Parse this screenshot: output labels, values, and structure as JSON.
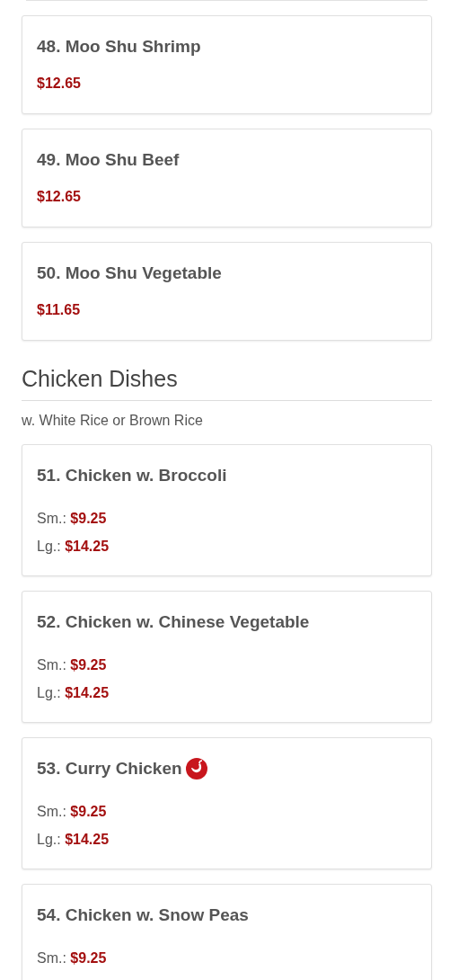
{
  "items_before": [
    {
      "kind": "single",
      "title": "48. Moo Shu Shrimp",
      "spicy": false,
      "price": "$12.65"
    },
    {
      "kind": "single",
      "title": "49. Moo Shu Beef",
      "spicy": false,
      "price": "$12.65"
    },
    {
      "kind": "single",
      "title": "50. Moo Shu Vegetable",
      "spicy": false,
      "price": "$11.65"
    }
  ],
  "section": {
    "title": "Chicken Dishes",
    "subtitle": "w. White Rice or Brown Rice",
    "items": [
      {
        "kind": "sized",
        "title": "51. Chicken w. Broccoli",
        "spicy": false,
        "prices": [
          {
            "label": "Sm.:",
            "price": "$9.25"
          },
          {
            "label": "Lg.:",
            "price": "$14.25"
          }
        ]
      },
      {
        "kind": "sized",
        "title": "52. Chicken w. Chinese Vegetable",
        "spicy": false,
        "prices": [
          {
            "label": "Sm.:",
            "price": "$9.25"
          },
          {
            "label": "Lg.:",
            "price": "$14.25"
          }
        ]
      },
      {
        "kind": "sized",
        "title": "53. Curry Chicken",
        "spicy": true,
        "prices": [
          {
            "label": "Sm.:",
            "price": "$9.25"
          },
          {
            "label": "Lg.:",
            "price": "$14.25"
          }
        ]
      },
      {
        "kind": "sized",
        "title": "54. Chicken w. Snow Peas",
        "spicy": false,
        "prices": [
          {
            "label": "Sm.:",
            "price": "$9.25"
          }
        ]
      }
    ]
  }
}
